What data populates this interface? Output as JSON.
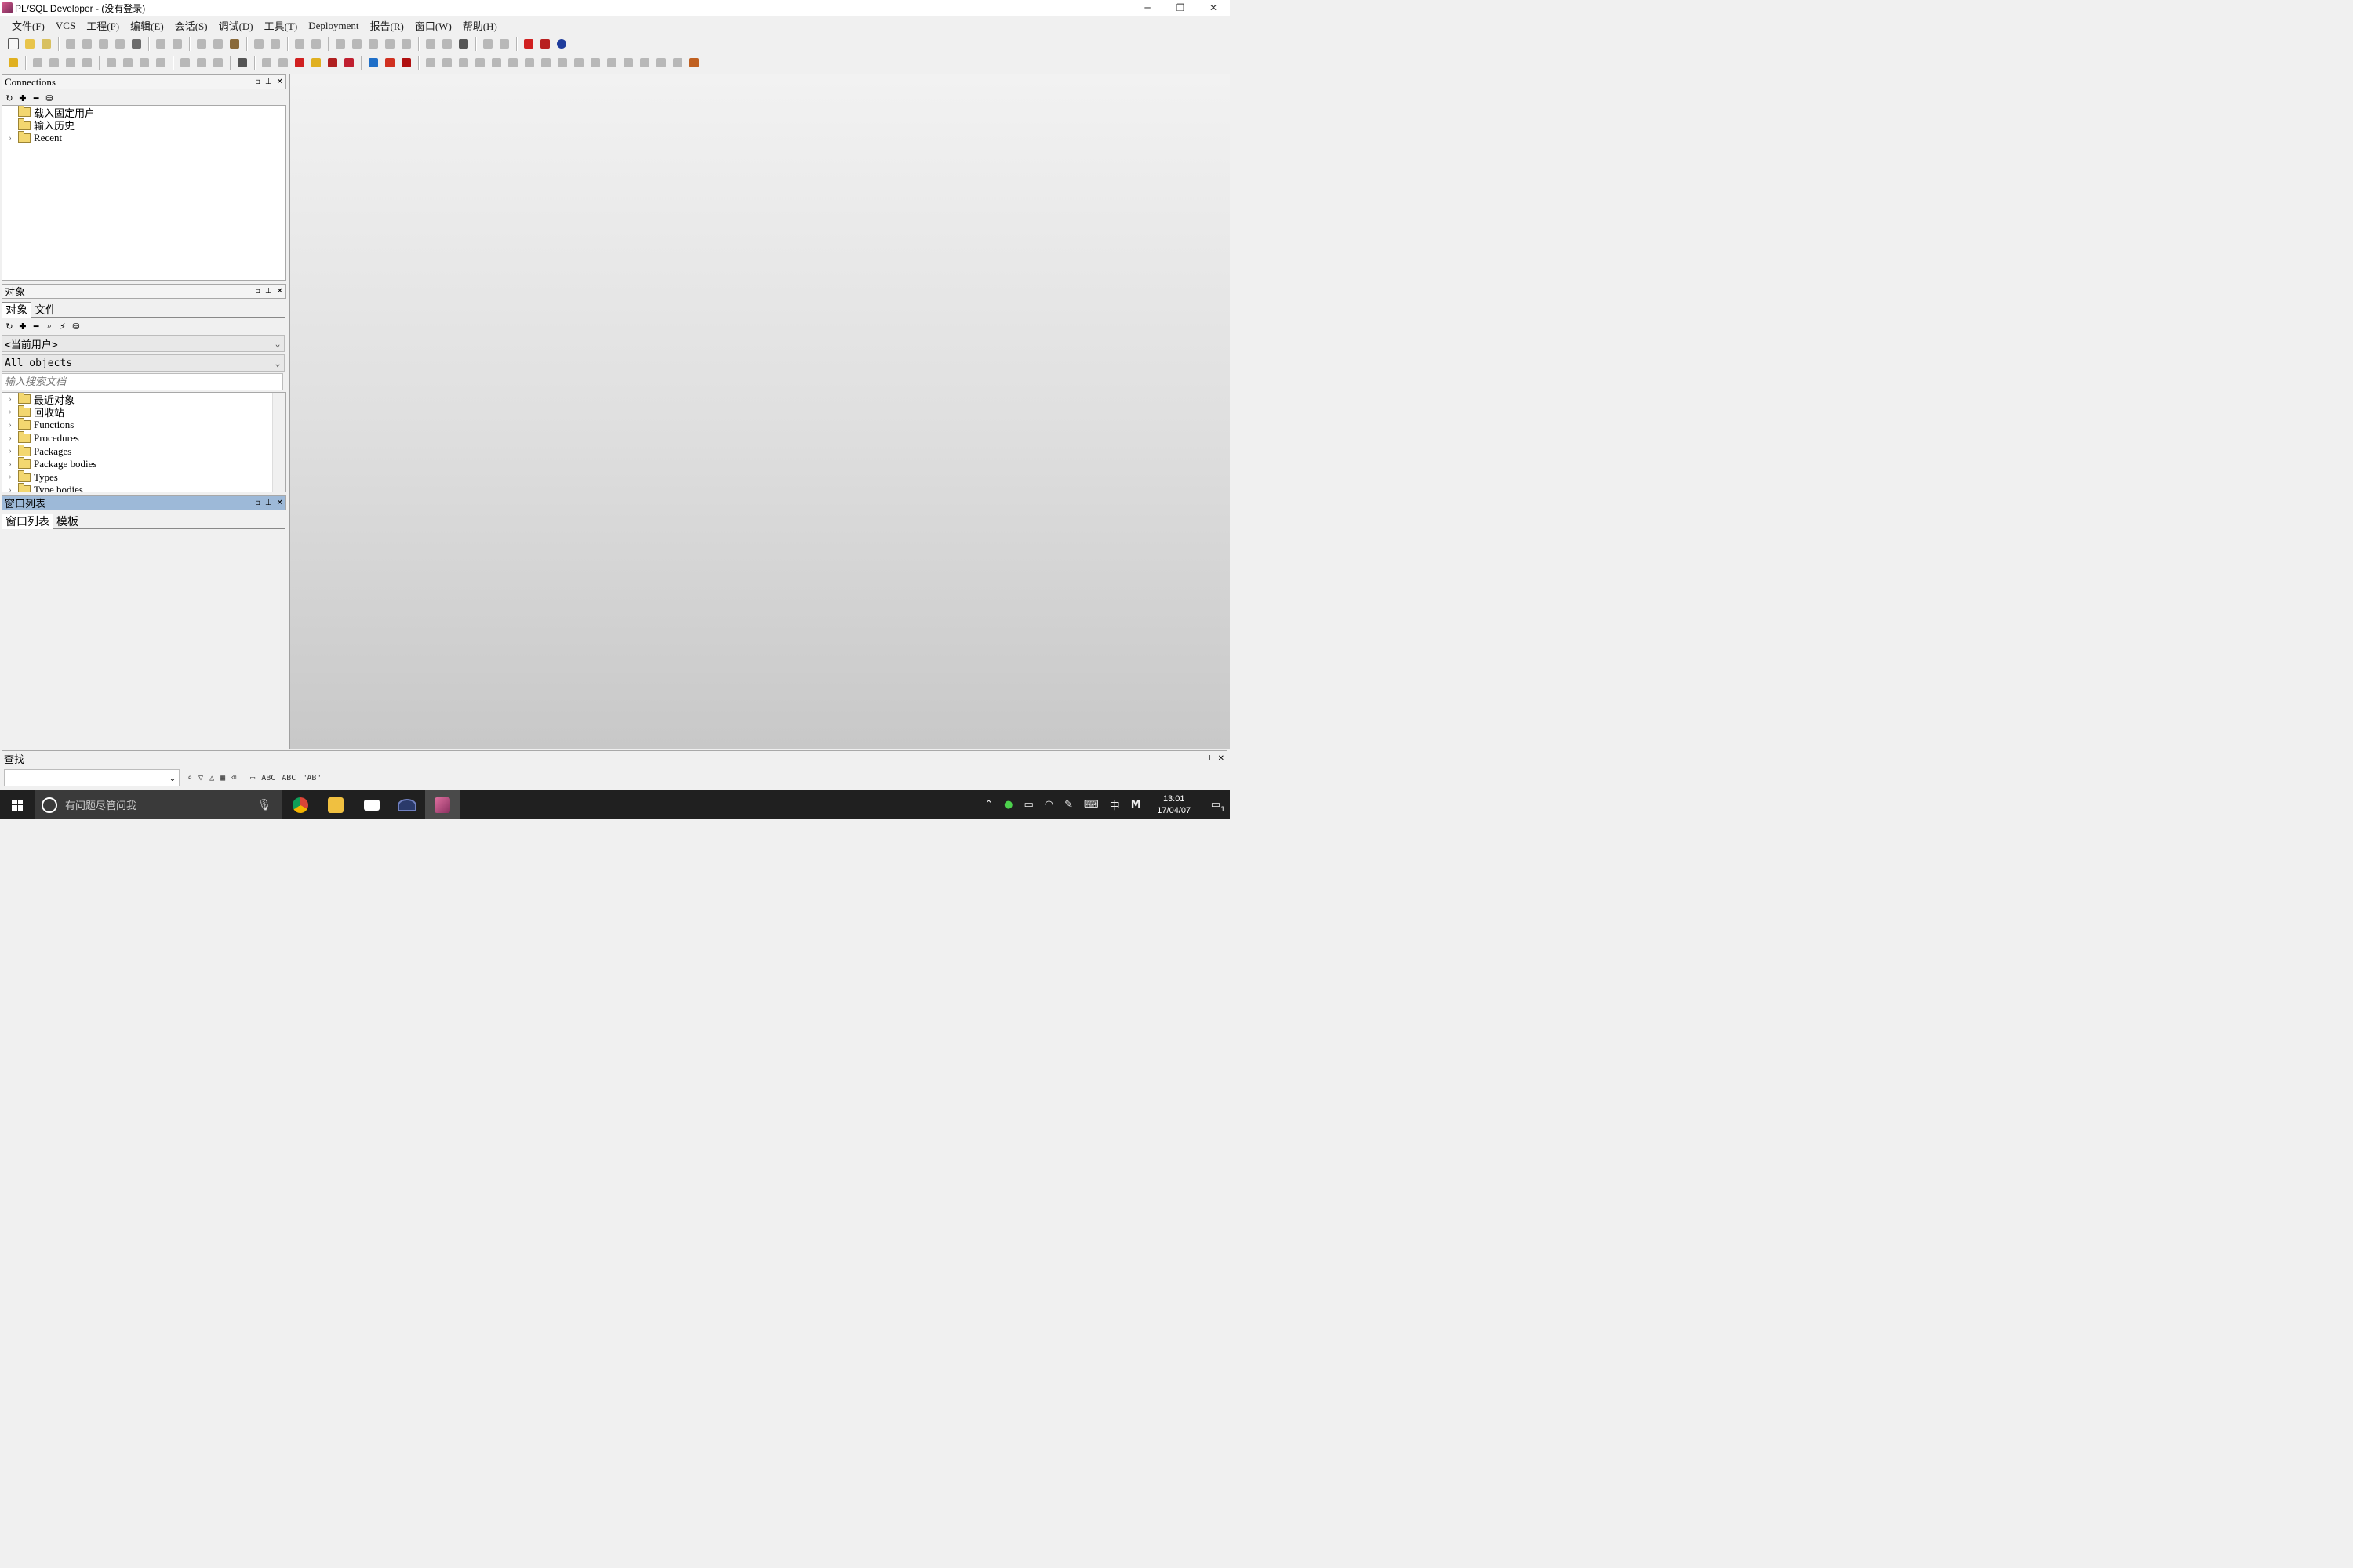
{
  "window": {
    "title": "PL/SQL Developer - (没有登录)",
    "buttons": [
      "─",
      "❐",
      "✕"
    ]
  },
  "menu": [
    "文件(F)",
    "VCS",
    "工程(P)",
    "编辑(E)",
    "会话(S)",
    "调试(D)",
    "工具(T)",
    "Deployment",
    "报告(R)",
    "窗口(W)",
    "帮助(H)"
  ],
  "connections": {
    "title": "Connections",
    "header_buttons": [
      "▫",
      "⊥",
      "✕"
    ],
    "toolbar_icons": [
      "refresh-icon",
      "add-icon",
      "remove-icon",
      "connect-icon"
    ],
    "items": [
      {
        "label": "载入固定用户",
        "expandable": false
      },
      {
        "label": "输入历史",
        "expandable": false
      },
      {
        "label": "Recent",
        "expandable": true
      }
    ]
  },
  "objects": {
    "title": "对象",
    "header_buttons": [
      "▫",
      "⊥",
      "✕"
    ],
    "tabs": [
      "对象",
      "文件"
    ],
    "toolbar_icons": [
      "refresh-icon",
      "add-icon",
      "remove-icon",
      "find-icon",
      "filter-icon",
      "connect-icon"
    ],
    "user_select": "<当前用户>",
    "filter_select": "All objects",
    "search_placeholder": "输入搜索文档",
    "items": [
      "最近对象",
      "回收站",
      "Functions",
      "Procedures",
      "Packages",
      "Package bodies",
      "Types",
      "Type bodies"
    ]
  },
  "window_list": {
    "title": "窗口列表",
    "header_buttons": [
      "▫",
      "⊥",
      "✕"
    ],
    "tabs": [
      "窗口列表",
      "模板"
    ]
  },
  "find": {
    "title": "查找",
    "header_buttons": [
      "⊥",
      "✕"
    ],
    "buttons": [
      "ABC",
      "ABC",
      "\"AB\""
    ]
  },
  "taskbar": {
    "search_text": "有问题尽管问我",
    "ime": "中",
    "ime2": "M",
    "time": "13:01",
    "date": "17/04/07",
    "notification_count": "1"
  }
}
